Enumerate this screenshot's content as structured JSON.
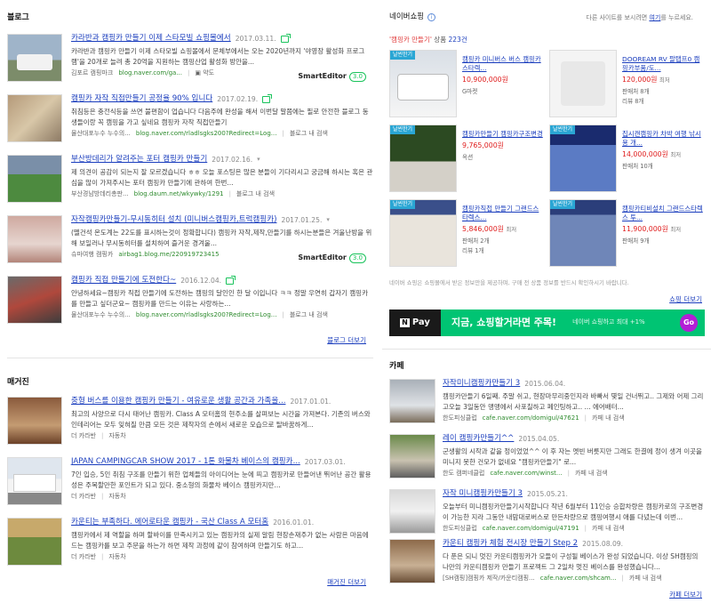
{
  "blog": {
    "title": "블로그",
    "more": "블로그 더보기",
    "items": [
      {
        "title": "카라반과 캠핑카 만들기 이제 스타모빌 쇼핑몰에서",
        "date": "2017.03.11.",
        "desc": "카라반과 캠핑카 만들기 이제 스타모빌 쇼핑몰에서 문체부에서는 오는 2020년까지 '야영장 활성화 프로그램'을 20개로 늘려 총 20억을 지원하는 캠핑산업 활성화 방안을...",
        "source": "김포르 캠핑마크",
        "url": "blog.naver.com/ga...",
        "extra": "약도",
        "smarteditor": "SmartEditor",
        "se_ver": "3.0"
      },
      {
        "title": "캠핑카 자작 직접만들기 공정율 90% 입니다",
        "date": "2017.02.19.",
        "desc": "취침등은 충전식등을 쓰면 불편함이 업습니다 다음주에 완성을 해서 이번달 말쯤에는 필로 안전한 블로그 동생들이랑 꼭 캠핑을 가고 싶네요 캠핑카 자작 직접만들기",
        "source": "물산대포누수 누수의...",
        "url": "blog.naver.com/rladlsgks200?Redirect=Log...",
        "extra": "블로그 내 검색"
      },
      {
        "title": "부산방데리가 알려주는 포터 캠핑카 만들기",
        "date": "2017.02.16.",
        "desc": "제 의견이 공감이 되는지 잘 모르겠습니다 ㅎㅎ 오늘 포스팅은 많은 분들이 기다리시고 궁금해 하시는 혹은 관심을 많이 가져주시는 포터 캠핑카 만들기에 관하여 한번...",
        "source": "부산경남방데리총판...",
        "url": "blog.daum.net/wkywky/1291",
        "extra": "블로그 내 검색"
      },
      {
        "title": "자작캠핑카만들기-무시동히터 설치 (미니버스캠핑카,트럭캠핑카)",
        "date": "2017.01.25.",
        "desc": "(뗄건석 온도계는 22도를 표시하는것이 정확합니다) 캠핑카 자작,제작,만들기를 하시는분들은 겨울난방을 위해 보일러나 무시동히터를 설치하여 즐거운 경겨울...",
        "source": "슈마여행 캠핑카",
        "url": "airbag1.blog.me/220919723415",
        "smarteditor": "SmartEditor",
        "se_ver": "3.0"
      },
      {
        "title": "캠핑카 직접 만들기에 도전한다~",
        "date": "2016.12.04.",
        "desc": "안녕하세요~캠핑카 직접 만들기에 도전하는 캠핑의 달인인 한 달 이입니다 ㅋㅋ 정말 우연히 갑자기 캠핑카를 만들고 싶더군요~ 캠핑카를 만드는 이유는 사랑하는...",
        "source": "물산대포누수 누수의...",
        "url": "blog.naver.com/rladlsgks200?Redirect=Log...",
        "extra": "블로그 내 검색"
      }
    ]
  },
  "magazine": {
    "title": "매거진",
    "more": "매거진 더보기",
    "items": [
      {
        "title": "중형 버스를 이용한 캠핑카 만들기 - 여유로운 생활 공간과 가족을...",
        "date": "2017.01.01.",
        "desc": "최고의 사양으로 다시 태어난 캠핑카. Class A 모터홈의 현주소를 살펴보는 시간을 가져본다. 기존의 버스와 인테리어는 모두 잊혀질 만큼 모든 것은 제작자의 손에서 새로운 모습으로 탈바꿈하게...",
        "source": "더 카라반",
        "cat": "자동차"
      },
      {
        "title": "JAPAN CAMPINGCAR SHOW 2017 - 1톤 화물차 베이스의 캠핑카...",
        "date": "2017.03.01.",
        "desc": "7인 입승, 5인 취침 구조를 만들기 위한 업체들의 아이디어는 눈에 띄고 캠핑카로 만들어낸 뛰어난 공간 활용성은 주목할만한 포인트가 되고 있다. 중소형의 화물차 베이스 캠핑카지만...",
        "source": "더 카라반",
        "cat": "자동차"
      },
      {
        "title": "카운티는 부족하다. 에어로타운 캠핑카 - 국산 Class A 모터홈",
        "date": "2016.01.01.",
        "desc": "캠핑카에서 제 역할을 하며 할바이를 만족시키고 있는 캠핑카의 실제 알림 현장손재주가 없는 사람은 마음에 드는 캠핑카를 보고 주문을 하는가 하면 제작 과정에 같이 참여하며 만들기도 하고...",
        "source": "더 카라반",
        "cat": "자동차"
      }
    ]
  },
  "shopping": {
    "title": "네이버쇼핑",
    "note_pre": "다른 사이트를 보시려면 ",
    "note_link": "여기",
    "note_post": "를 누르세요.",
    "query": "'캠핑카 만들기'",
    "query_label": " 상품 ",
    "count": "223건",
    "tag": "날씬한기",
    "products": [
      {
        "name": "캠핑카 미니버스 버스 캠핑카 스타렉...",
        "price": "10,900,000원",
        "seller": "G마켓"
      },
      {
        "name": "DOOREAM RV 팔탭프0 캠핑카부품/도...",
        "price": "120,000원",
        "price_sub": "최저",
        "seller": "판매처 8개",
        "review": "리뷰 8개"
      },
      {
        "name": "캠핑카만들기 캠핑카구조변경",
        "price": "9,765,000원",
        "seller": "옥션"
      },
      {
        "name": "집시캔캠핑카 차박 여행 낚시용 개...",
        "price": "14,000,000원",
        "price_sub": "최저",
        "seller": "판매처 10개"
      },
      {
        "name": "캠핑카직접 만들기 그랜드스타렉스...",
        "price": "5,846,000원",
        "price_sub": "최저",
        "seller": "판매처 2개",
        "review": "리뷰 1개"
      },
      {
        "name": "캠핑카티비설치 그랜드스타렉스 투...",
        "price": "11,900,000원",
        "price_sub": "최저",
        "seller": "판매처 9개"
      }
    ],
    "footnote": "네이버 쇼핑은 쇼핑몰에서 받은 정보만을 제공하며, 구매 전 상품 정보를 반드시 확인하시기 바랍니다.",
    "more": "쇼핑 더보기"
  },
  "npay": {
    "logo": "N",
    "logo_text": "Pay",
    "msg": "지금, 쇼핑할거라면 주목!",
    "sub": "네이버 쇼핑하고 최대 +1%",
    "go": "Go"
  },
  "cafe": {
    "title": "카페",
    "more": "카페 더보기",
    "items": [
      {
        "title": "자작미니캠핑카만들기 3",
        "date": "2015.06.04.",
        "desc": "캠핑카만들기 6일째. 주말 쉬고, 현장마무리중인지라 바빠서 몇일 건너뛰고.. 그제와 어제 그리고오늘 3일동안 맹맹에서 사포칠하고 페인팅하고.. ... 에어배터...",
        "source": "한도피싱클럽",
        "url": "cafe.naver.com/domigul/47621",
        "extra": "카페 내 검색"
      },
      {
        "title": "레이 캠핑카만들기^^",
        "date": "2015.04.05.",
        "desc": "군생활의 시작과 같을 정이었었^^ 이 후 자는 옛빈 버릇지만 그래도 한결에 정이 생겨 이곳을 미니지 못한 건모가 없네요 \"캠핑카만들기\" 로...",
        "source": "한도 캠퍼네클럽",
        "url": "cafe.naver.com/winst...",
        "extra": "카페 내 검색"
      },
      {
        "title": "자작 미니캠핑카만들기 3",
        "date": "2015.05.21.",
        "desc": "오늘부터 미니캠핑카만들기시작합니다 작년 6월부터 11인승 승합차량은 캠핑카로의 구조변경이 가능한 지라 그동안 내맘대로버스로 만든차량으로 캠핑여행시 애를 다녔는데 이번...",
        "source": "한도피싱클럽",
        "url": "cafe.naver.com/domigul/47191",
        "extra": "카페 내 검색"
      },
      {
        "title": "카운티 캠핑카 체험 전시장 만들기 Step 2",
        "date": "2015.08.09.",
        "desc": "다 푼은 되니 멋진 카운티캠핑카가 모들이 구성될 베이스가 완성 되었습니다. 이상 SH캠핑의 나만의 카운티캠핑카 만들기 프로젝트 그 2일차 멋진 베이스를 완성했습니다...",
        "source": "[SH캠핑]캠핑카 제작/카운티캠핑...",
        "url": "cafe.naver.com/shcam...",
        "extra": "카페 내 검색"
      }
    ]
  },
  "colors": {
    "link": "#1a3dbd",
    "green": "#19c35b",
    "price": "#e02020",
    "npay": "#00c473"
  }
}
